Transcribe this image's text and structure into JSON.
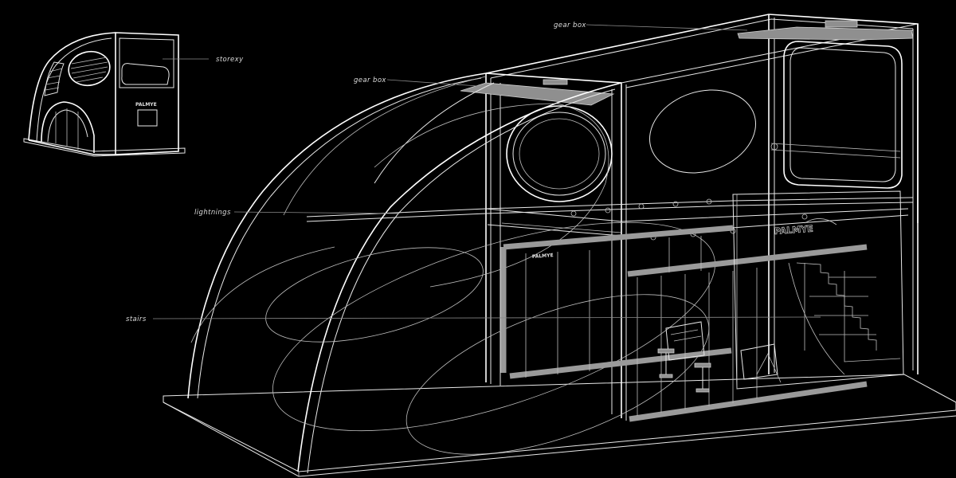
{
  "diagram": {
    "labels": {
      "storey": "storexy",
      "gear_box_top": "gear box",
      "gear_box_left": "gear box",
      "lightnings": "lightnings",
      "stairs": "stairs"
    },
    "brand": {
      "main": "PALMYE",
      "lower": "PALMYE",
      "thumb": "PALMYE"
    },
    "colors": {
      "background": "#000000",
      "lines": "#e8e8e8",
      "accent_grey": "#8f8f8f"
    }
  }
}
